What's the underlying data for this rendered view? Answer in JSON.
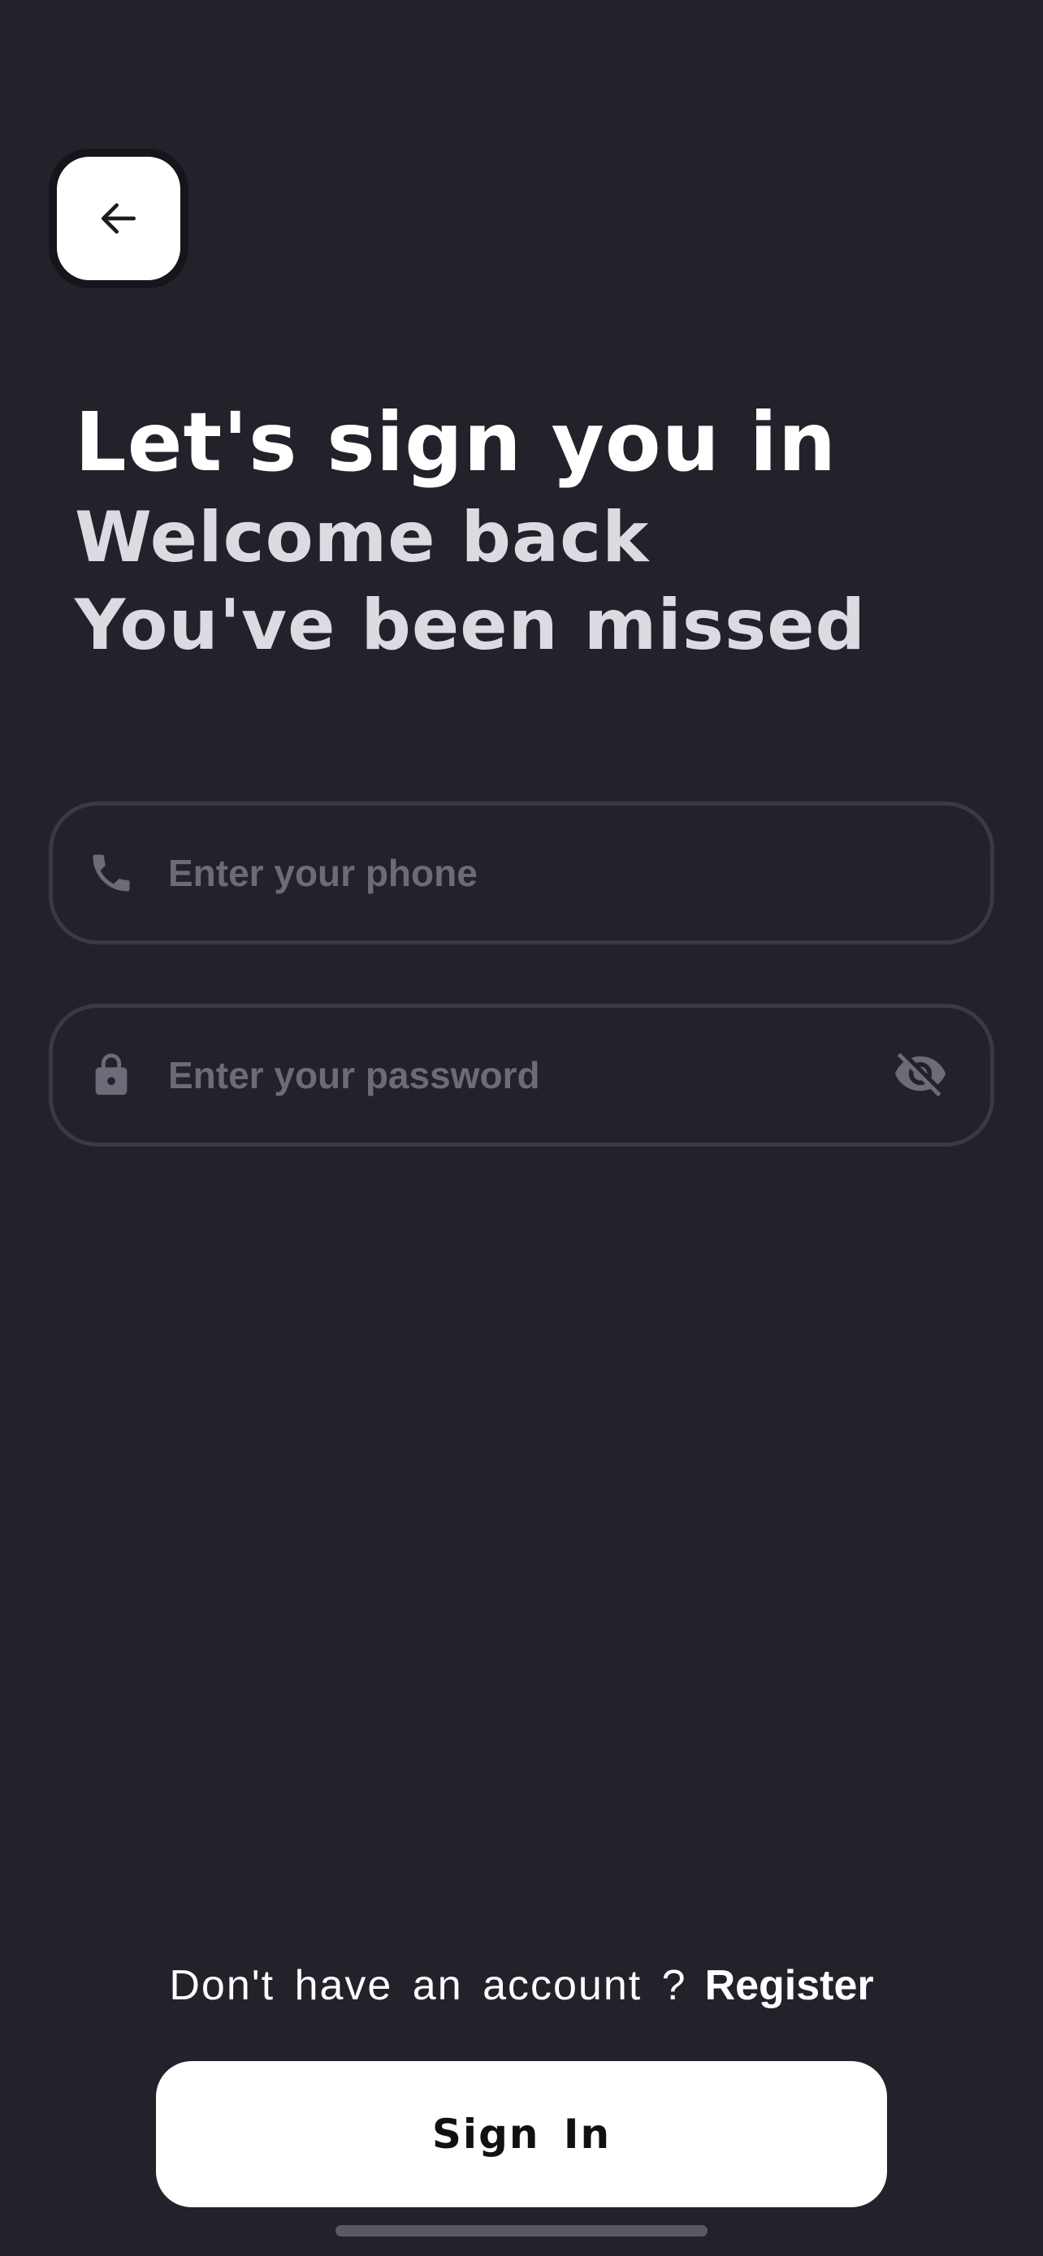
{
  "header": {
    "back_icon": "arrow-left-icon"
  },
  "intro": {
    "title": "Let's sign you in",
    "subtitle_line1": "Welcome back",
    "subtitle_line2": "You've been missed"
  },
  "form": {
    "phone": {
      "icon": "phone-icon",
      "value": "",
      "placeholder": "Enter your phone"
    },
    "password": {
      "icon": "lock-icon",
      "value": "",
      "placeholder": "Enter your password",
      "visibility_icon": "eye-off-icon"
    }
  },
  "footer": {
    "register_prompt": "Don't have an account ?",
    "register_link": "Register",
    "signin_label": "Sign In"
  },
  "colors": {
    "background": "#23222b",
    "field_border": "#3a3944",
    "placeholder": "#6c6b78",
    "primary_button": "#ffffff",
    "subtitle_text": "#dcdbe2"
  }
}
